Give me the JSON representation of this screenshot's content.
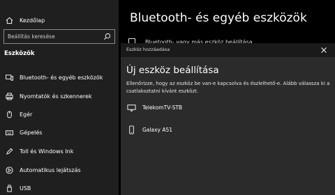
{
  "sidebar": {
    "home_label": "Kezdőlap",
    "search_placeholder": "Beállítás keresése",
    "section_title": "Eszközök",
    "items": [
      {
        "label": "Bluetooth- és egyéb eszközök",
        "icon": "bluetooth-icon"
      },
      {
        "label": "Nyomtatók és szkennerek",
        "icon": "printer-icon"
      },
      {
        "label": "Egér",
        "icon": "mouse-icon"
      },
      {
        "label": "Gépelés",
        "icon": "keyboard-icon"
      },
      {
        "label": "Toll és Windows Ink",
        "icon": "pen-icon"
      },
      {
        "label": "Automatikus lejátszás",
        "icon": "autoplay-icon"
      },
      {
        "label": "USB",
        "icon": "usb-icon"
      }
    ]
  },
  "main": {
    "title": "Bluetooth- és egyéb eszközök",
    "add_device_label": "Bluetooth- vagy más eszköz beállítása"
  },
  "dialog": {
    "window_title": "Eszköz hozzáadása",
    "heading": "Új eszköz beállítása",
    "description": "Ellenőrizze, hogy az eszköz be van-e kapcsolva és észlelhető-e. Alább válassza ki a csatlakoztatni kívánt eszközt.",
    "devices": [
      {
        "name": "TelekomTV-STB",
        "icon": "display-icon"
      },
      {
        "name": "Galaxy A51",
        "icon": "phone-icon"
      }
    ]
  }
}
